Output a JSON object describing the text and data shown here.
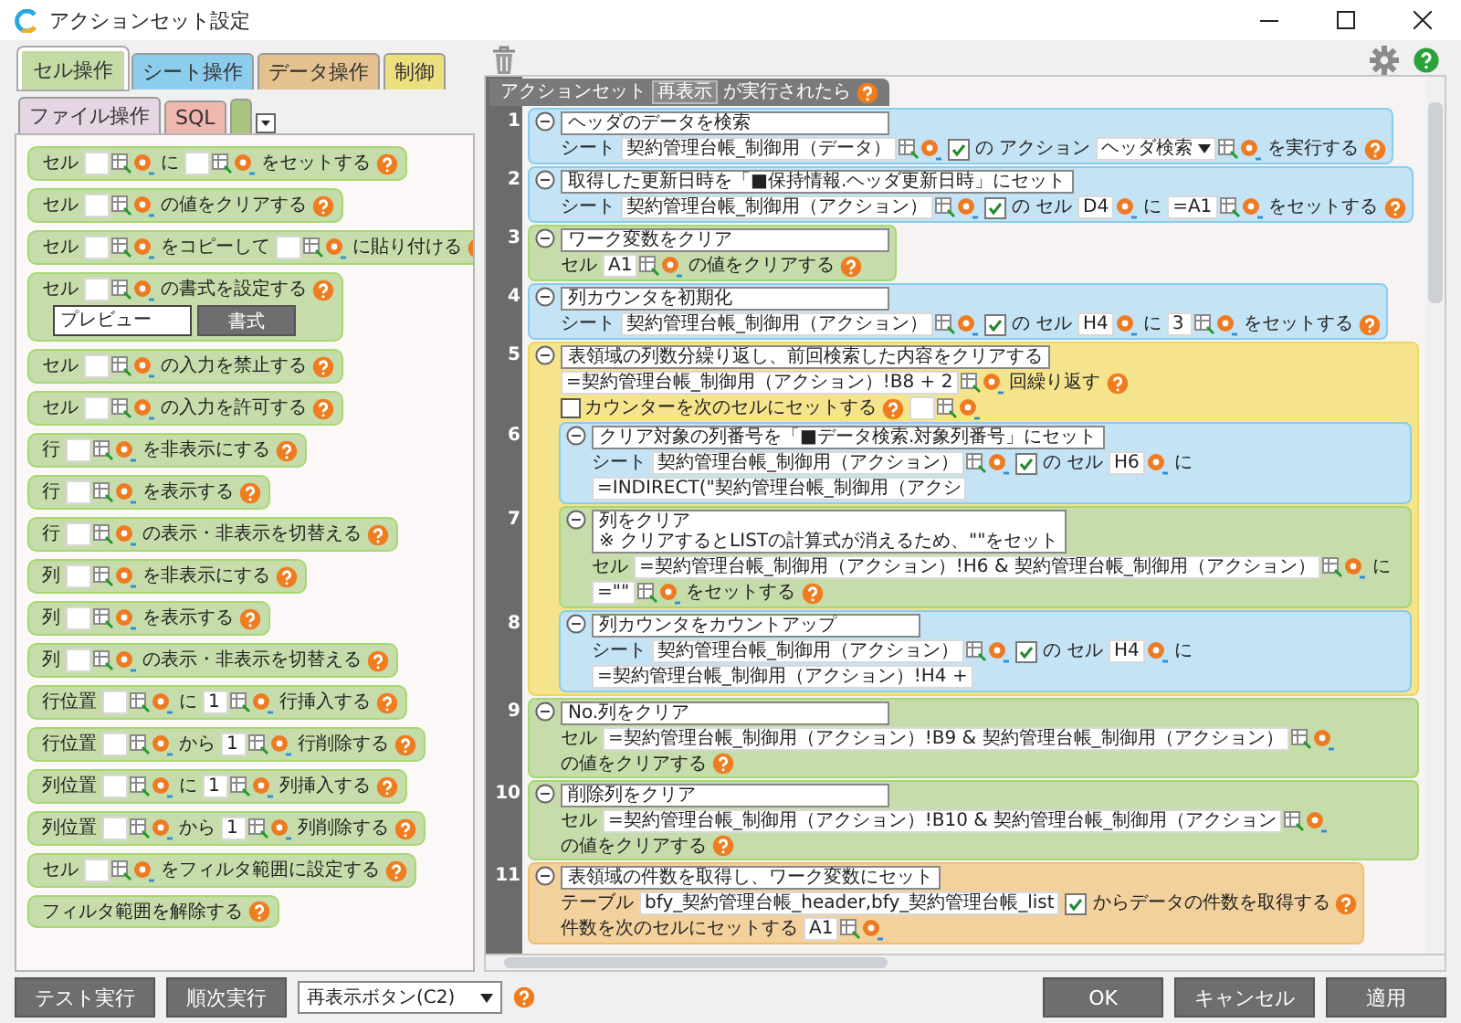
{
  "window": {
    "title": "アクションセット設定"
  },
  "palette": {
    "tabs": [
      {
        "label": "セル操作",
        "selected": true,
        "color": "#c4dba6"
      },
      {
        "label": "シート操作",
        "selected": false,
        "color": "#8ccdee"
      },
      {
        "label": "データ操作",
        "selected": false,
        "color": "#e3c28f"
      },
      {
        "label": "制御",
        "selected": false,
        "color": "#ece07e"
      },
      {
        "label": "ファイル操作",
        "selected": false,
        "color": "#e4d6e2"
      },
      {
        "label": "SQL",
        "selected": false,
        "color": "#efb8ae"
      },
      {
        "selected": false,
        "color": "#a9c47c"
      }
    ],
    "blocks": [
      {
        "parts": [
          {
            "kind": "text",
            "text": "セル"
          },
          {
            "kind": "field"
          },
          {
            "kind": "text",
            "text": "に"
          },
          {
            "kind": "field"
          },
          {
            "kind": "text",
            "text": "をセットする"
          },
          {
            "kind": "help"
          }
        ]
      },
      {
        "parts": [
          {
            "kind": "text",
            "text": "セル"
          },
          {
            "kind": "field"
          },
          {
            "kind": "text",
            "text": "の値をクリアする"
          },
          {
            "kind": "help"
          }
        ]
      },
      {
        "parts": [
          {
            "kind": "text",
            "text": "セル"
          },
          {
            "kind": "field"
          },
          {
            "kind": "text",
            "text": "をコピーして"
          },
          {
            "kind": "field"
          },
          {
            "kind": "text",
            "text": "に貼り付ける"
          },
          {
            "kind": "help"
          }
        ]
      },
      {
        "parts": [
          {
            "kind": "text",
            "text": "セル"
          },
          {
            "kind": "field"
          },
          {
            "kind": "text",
            "text": "の書式を設定する"
          },
          {
            "kind": "help"
          }
        ],
        "preview": "プレビュー",
        "button": "書式"
      },
      {
        "parts": [
          {
            "kind": "text",
            "text": "セル"
          },
          {
            "kind": "field"
          },
          {
            "kind": "text",
            "text": "の入力を禁止する"
          },
          {
            "kind": "help"
          }
        ]
      },
      {
        "parts": [
          {
            "kind": "text",
            "text": "セル"
          },
          {
            "kind": "field"
          },
          {
            "kind": "text",
            "text": "の入力を許可する"
          },
          {
            "kind": "help"
          }
        ]
      },
      {
        "parts": [
          {
            "kind": "text",
            "text": "行"
          },
          {
            "kind": "field"
          },
          {
            "kind": "text",
            "text": "を非表示にする"
          },
          {
            "kind": "help"
          }
        ]
      },
      {
        "parts": [
          {
            "kind": "text",
            "text": "行"
          },
          {
            "kind": "field"
          },
          {
            "kind": "text",
            "text": "を表示する"
          },
          {
            "kind": "help"
          }
        ]
      },
      {
        "parts": [
          {
            "kind": "text",
            "text": "行"
          },
          {
            "kind": "field"
          },
          {
            "kind": "text",
            "text": "の表示・非表示を切替える"
          },
          {
            "kind": "help"
          }
        ]
      },
      {
        "parts": [
          {
            "kind": "text",
            "text": "列"
          },
          {
            "kind": "field"
          },
          {
            "kind": "text",
            "text": "を非表示にする"
          },
          {
            "kind": "help"
          }
        ]
      },
      {
        "parts": [
          {
            "kind": "text",
            "text": "列"
          },
          {
            "kind": "field"
          },
          {
            "kind": "text",
            "text": "を表示する"
          },
          {
            "kind": "help"
          }
        ]
      },
      {
        "parts": [
          {
            "kind": "text",
            "text": "列"
          },
          {
            "kind": "field"
          },
          {
            "kind": "text",
            "text": "の表示・非表示を切替える"
          },
          {
            "kind": "help"
          }
        ]
      },
      {
        "parts": [
          {
            "kind": "text",
            "text": "行位置"
          },
          {
            "kind": "field"
          },
          {
            "kind": "text",
            "text": "に"
          },
          {
            "kind": "field",
            "value": "1"
          },
          {
            "kind": "text",
            "text": "行挿入する"
          },
          {
            "kind": "help"
          }
        ]
      },
      {
        "parts": [
          {
            "kind": "text",
            "text": "行位置"
          },
          {
            "kind": "field"
          },
          {
            "kind": "text",
            "text": "から"
          },
          {
            "kind": "field",
            "value": "1"
          },
          {
            "kind": "text",
            "text": "行削除する"
          },
          {
            "kind": "help"
          }
        ]
      },
      {
        "parts": [
          {
            "kind": "text",
            "text": "列位置"
          },
          {
            "kind": "field"
          },
          {
            "kind": "text",
            "text": "に"
          },
          {
            "kind": "field",
            "value": "1"
          },
          {
            "kind": "text",
            "text": "列挿入する"
          },
          {
            "kind": "help"
          }
        ]
      },
      {
        "parts": [
          {
            "kind": "text",
            "text": "列位置"
          },
          {
            "kind": "field"
          },
          {
            "kind": "text",
            "text": "から"
          },
          {
            "kind": "field",
            "value": "1"
          },
          {
            "kind": "text",
            "text": "列削除する"
          },
          {
            "kind": "help"
          }
        ]
      },
      {
        "parts": [
          {
            "kind": "text",
            "text": "セル"
          },
          {
            "kind": "field"
          },
          {
            "kind": "text",
            "text": "をフィルタ範囲に設定する"
          },
          {
            "kind": "help"
          }
        ]
      },
      {
        "parts": [
          {
            "kind": "text",
            "text": "フィルタ範囲を解除する"
          },
          {
            "kind": "help"
          }
        ]
      }
    ]
  },
  "editor": {
    "trigger": [
      {
        "kind": "text",
        "text": "アクションセット"
      },
      {
        "kind": "token",
        "text": "再表示"
      },
      {
        "kind": "text",
        "text": "が実行されたら"
      },
      {
        "kind": "help"
      }
    ],
    "blocks": [
      {
        "number": "1",
        "kind": "sheet",
        "title": "ヘッダのデータを検索",
        "lines": [
          {
            "parts": [
              {
                "kind": "text",
                "text": "シート"
              },
              {
                "kind": "field",
                "value": "契約管理台帳_制御用（データ）"
              },
              {
                "kind": "check"
              },
              {
                "kind": "text",
                "text": "の"
              },
              {
                "kind": "text",
                "text": "アクション"
              },
              {
                "kind": "select",
                "value": "ヘッダ検索"
              },
              {
                "kind": "text",
                "text": "を実行する"
              },
              {
                "kind": "help"
              }
            ]
          }
        ]
      },
      {
        "number": "2",
        "kind": "sheet",
        "title": "取得した更新日時を「■保持情報.ヘッダ更新日時」にセット",
        "lines": [
          {
            "parts": [
              {
                "kind": "text",
                "text": "シート"
              },
              {
                "kind": "field",
                "value": "契約管理台帳_制御用（アクション）"
              },
              {
                "kind": "check"
              },
              {
                "kind": "text",
                "text": "の"
              },
              {
                "kind": "text",
                "text": "セル"
              },
              {
                "kind": "cell",
                "value": "D4"
              },
              {
                "kind": "text",
                "text": "に"
              },
              {
                "kind": "field",
                "value": "=A1"
              },
              {
                "kind": "text",
                "text": "をセットする"
              },
              {
                "kind": "help"
              }
            ]
          }
        ]
      },
      {
        "number": "3",
        "kind": "cell",
        "title": "ワーク変数をクリア",
        "lines": [
          {
            "parts": [
              {
                "kind": "text",
                "text": "セル"
              },
              {
                "kind": "field",
                "value": "A1"
              },
              {
                "kind": "text",
                "text": "の値をクリアする"
              },
              {
                "kind": "help"
              }
            ]
          }
        ]
      },
      {
        "number": "4",
        "kind": "sheet",
        "title": "列カウンタを初期化",
        "lines": [
          {
            "parts": [
              {
                "kind": "text",
                "text": "シート"
              },
              {
                "kind": "field",
                "value": "契約管理台帳_制御用（アクション）"
              },
              {
                "kind": "check"
              },
              {
                "kind": "text",
                "text": "の"
              },
              {
                "kind": "text",
                "text": "セル"
              },
              {
                "kind": "cell",
                "value": "H4"
              },
              {
                "kind": "text",
                "text": "に"
              },
              {
                "kind": "field",
                "value": "3"
              },
              {
                "kind": "text",
                "text": "をセットする"
              },
              {
                "kind": "help"
              }
            ]
          }
        ]
      },
      {
        "number": "5",
        "kind": "control",
        "title": "表領域の列数分繰り返し、前回検索した内容をクリアする",
        "lines": [
          {
            "parts": [
              {
                "kind": "field",
                "value": "=契約管理台帳_制御用（アクション）!B8 + 2"
              },
              {
                "kind": "text",
                "text": "回繰り返す"
              },
              {
                "kind": "help"
              }
            ]
          },
          {
            "parts": [
              {
                "kind": "checkbox",
                "checked": false,
                "text": "カウンターを次のセルにセットする"
              },
              {
                "kind": "help"
              },
              {
                "kind": "field"
              }
            ]
          }
        ],
        "children": [
          {
            "number": "6",
            "kind": "sheet",
            "title": "クリア対象の列番号を「■データ検索.対象列番号」にセット",
            "lines": [
              {
                "parts": [
                  {
                    "kind": "text",
                    "text": "シート"
                  },
                  {
                    "kind": "field",
                    "value": "契約管理台帳_制御用（アクション）"
                  },
                  {
                    "kind": "check"
                  },
                  {
                    "kind": "text",
                    "text": "の"
                  },
                  {
                    "kind": "text",
                    "text": "セル"
                  },
                  {
                    "kind": "cell",
                    "value": "H6"
                  },
                  {
                    "kind": "text",
                    "text": "に"
                  },
                  {
                    "kind": "box",
                    "value": "=INDIRECT(\"契約管理台帳_制御用（アクシ"
                  }
                ]
              }
            ]
          },
          {
            "number": "7",
            "kind": "cell",
            "title": "列をクリア",
            "note": "※ クリアするとLISTの計算式が消えるため、\"\"をセット",
            "lines": [
              {
                "parts": [
                  {
                    "kind": "text",
                    "text": "セル"
                  },
                  {
                    "kind": "field",
                    "value": "=契約管理台帳_制御用（アクション）!H6 & 契約管理台帳_制御用（アクション）"
                  },
                  {
                    "kind": "text",
                    "text": "に"
                  },
                  {
                    "kind": "field",
                    "value": "=\"\""
                  },
                  {
                    "kind": "text",
                    "text": "をセットする"
                  },
                  {
                    "kind": "help"
                  }
                ]
              }
            ]
          },
          {
            "number": "8",
            "kind": "sheet",
            "title": "列カウンタをカウントアップ",
            "lines": [
              {
                "parts": [
                  {
                    "kind": "text",
                    "text": "シート"
                  },
                  {
                    "kind": "field",
                    "value": "契約管理台帳_制御用（アクション）"
                  },
                  {
                    "kind": "check"
                  },
                  {
                    "kind": "text",
                    "text": "の"
                  },
                  {
                    "kind": "text",
                    "text": "セル"
                  },
                  {
                    "kind": "cell",
                    "value": "H4"
                  },
                  {
                    "kind": "text",
                    "text": "に"
                  },
                  {
                    "kind": "box",
                    "value": "=契約管理台帳_制御用（アクション）!H4 +"
                  }
                ]
              }
            ]
          }
        ]
      },
      {
        "number": "9",
        "kind": "cell",
        "title": "No.列をクリア",
        "lines": [
          {
            "parts": [
              {
                "kind": "text",
                "text": "セル"
              },
              {
                "kind": "field",
                "value": "=契約管理台帳_制御用（アクション）!B9 & 契約管理台帳_制御用（アクション）"
              },
              {
                "kind": "text",
                "text": "の値をクリアする"
              },
              {
                "kind": "help"
              }
            ]
          }
        ]
      },
      {
        "number": "10",
        "kind": "cell",
        "title": "削除列をクリア",
        "lines": [
          {
            "parts": [
              {
                "kind": "text",
                "text": "セル"
              },
              {
                "kind": "field",
                "value": "=契約管理台帳_制御用（アクション）!B10 & 契約管理台帳_制御用（アクション"
              },
              {
                "kind": "text",
                "text": "の値をクリアする"
              },
              {
                "kind": "help"
              }
            ]
          }
        ]
      },
      {
        "number": "11",
        "kind": "table",
        "title": "表領域の件数を取得し、ワーク変数にセット",
        "lines": [
          {
            "parts": [
              {
                "kind": "text",
                "text": "テーブル"
              },
              {
                "kind": "box",
                "value": "bfy_契約管理台帳_header,bfy_契約管理台帳_list"
              },
              {
                "kind": "check"
              },
              {
                "kind": "text",
                "text": "からデータの件数を取得する"
              },
              {
                "kind": "help"
              }
            ]
          },
          {
            "parts": [
              {
                "kind": "text",
                "text": "件数を次のセルにセットする"
              },
              {
                "kind": "field",
                "value": "A1"
              }
            ]
          }
        ]
      }
    ]
  },
  "footer": {
    "left_buttons": [
      "テスト実行",
      "順次実行"
    ],
    "select": "再表示ボタン(C2)",
    "right_buttons": [
      "OK",
      "キャンセル",
      "適用"
    ]
  }
}
